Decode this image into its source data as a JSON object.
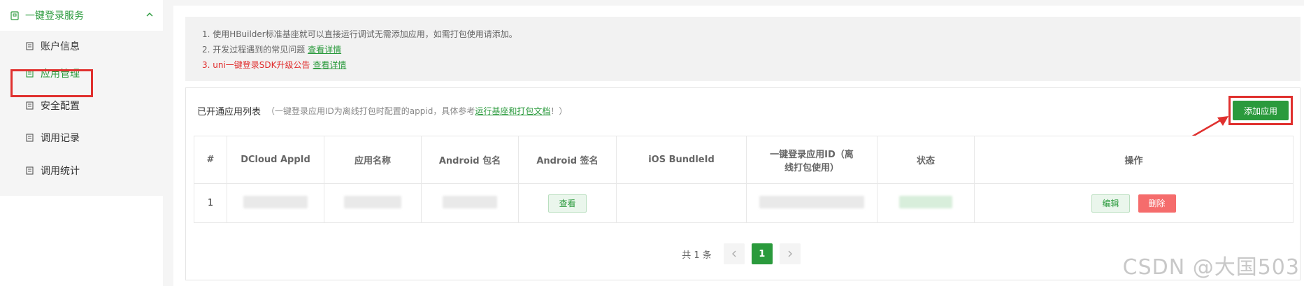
{
  "sidebar": {
    "group_label": "一键登录服务",
    "items": [
      {
        "label": "账户信息"
      },
      {
        "label": "应用管理"
      },
      {
        "label": "安全配置"
      },
      {
        "label": "调用记录"
      },
      {
        "label": "调用统计"
      }
    ],
    "active_index": 1
  },
  "notice": {
    "line1": "1. 使用HBuilder标准基座就可以直接运行调试无需添加应用，如需打包使用请添加。",
    "line2_text": "2. 开发过程遇到的常见问题",
    "line2_link": "查看详情",
    "line3_text": "3. uni一键登录SDK升级公告",
    "line3_link": "查看详情"
  },
  "panel": {
    "title": "已开通应用列表",
    "desc_prefix": "（一键登录应用ID为离线打包时配置的appid，具体参考",
    "desc_link": "运行基座和打包文档",
    "desc_suffix": "！）",
    "add_button": "添加应用"
  },
  "table": {
    "headers": [
      "#",
      "DCloud AppId",
      "应用名称",
      "Android 包名",
      "Android 签名",
      "iOS BundleId",
      "一键登录应用ID（离线打包使用）",
      "状态",
      "操作"
    ],
    "rows": [
      {
        "index": "1",
        "view_button": "查看",
        "edit_button": "编辑",
        "delete_button": "删除"
      }
    ]
  },
  "pagination": {
    "total": "共 1 条",
    "current": "1",
    "prev_icon": "chevron-left-icon",
    "next_icon": "chevron-right-icon"
  },
  "watermark": "CSDN @大国503",
  "colors": {
    "accent": "#2a9a3c",
    "danger": "#f56c6c",
    "highlight": "#e0302e"
  }
}
